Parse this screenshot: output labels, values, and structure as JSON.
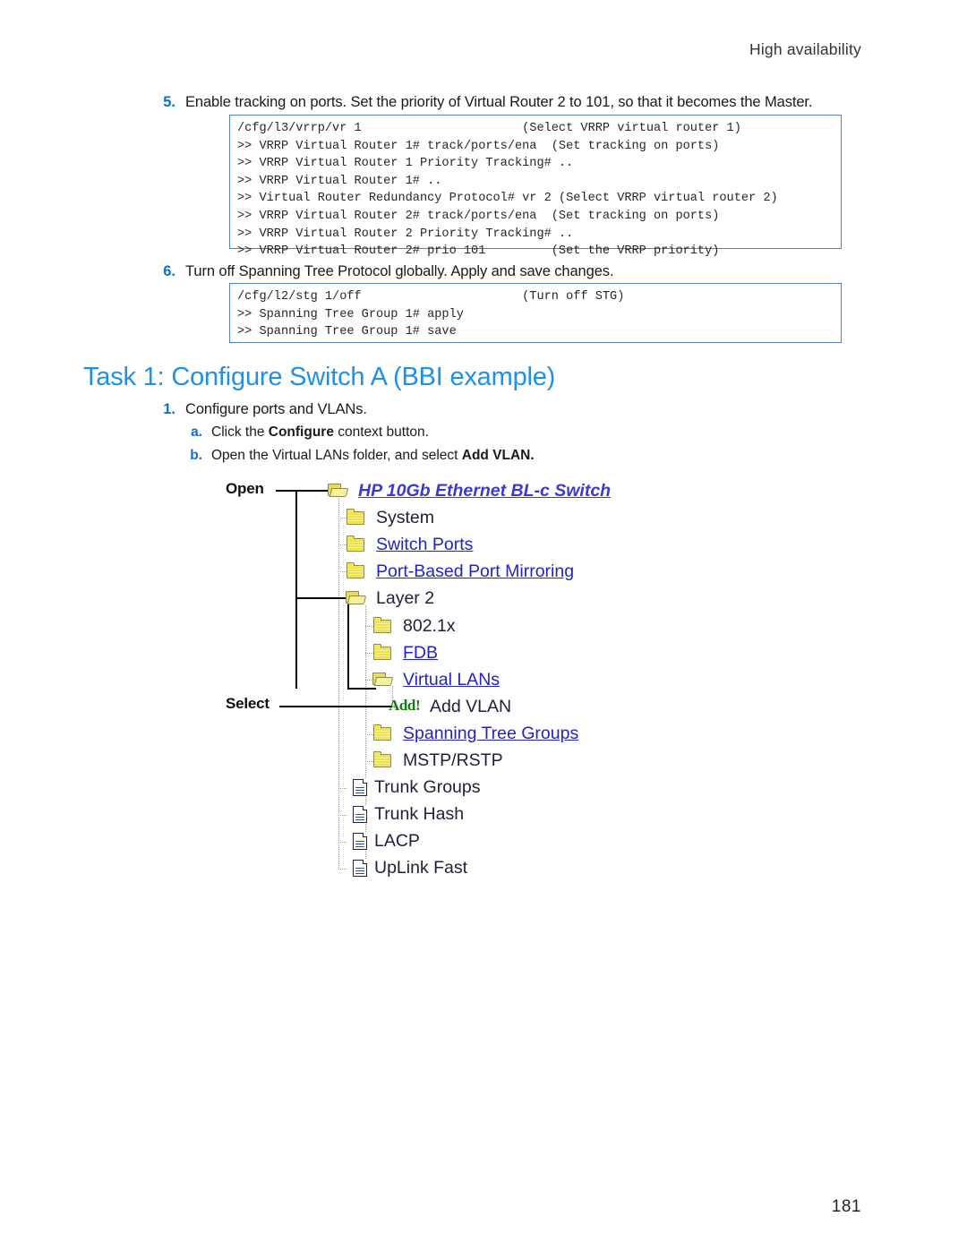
{
  "header": {
    "running_head": "High availability"
  },
  "footer": {
    "page_number": "181"
  },
  "steps": [
    {
      "num": "5.",
      "text": "Enable tracking on ports. Set the priority of Virtual Router 2 to 101, so that it becomes the Master."
    },
    {
      "num": "6.",
      "text": "Turn off Spanning Tree Protocol globally. Apply and save changes."
    }
  ],
  "code_blocks": [
    {
      "name": "vrrp-tracking-cli",
      "lines": [
        "/cfg/l3/vrrp/vr 1                      (Select VRRP virtual router 1)",
        ">> VRRP Virtual Router 1# track/ports/ena  (Set tracking on ports)",
        ">> VRRP Virtual Router 1 Priority Tracking# ..",
        ">> VRRP Virtual Router 1# ..",
        ">> Virtual Router Redundancy Protocol# vr 2 (Select VRRP virtual router 2)",
        ">> VRRP Virtual Router 2# track/ports/ena  (Set tracking on ports)",
        ">> VRRP Virtual Router 2 Priority Tracking# ..",
        ">> VRRP Virtual Router 2# prio 101         (Set the VRRP priority)"
      ]
    },
    {
      "name": "stg-off-cli",
      "lines": [
        "/cfg/l2/stg 1/off                      (Turn off STG)",
        ">> Spanning Tree Group 1# apply",
        ">> Spanning Tree Group 1# save"
      ]
    }
  ],
  "task": {
    "heading": "Task 1: Configure Switch A (BBI example)",
    "step": {
      "num": "1.",
      "text": "Configure ports and VLANs."
    },
    "substeps": [
      {
        "letter": "a.",
        "pre": "Click the ",
        "bold": "Configure",
        "post": " context button."
      },
      {
        "letter": "b.",
        "pre": "Open the Virtual LANs folder, and select ",
        "bold": "Add VLAN.",
        "post": ""
      }
    ]
  },
  "tree_figure": {
    "annotations": [
      {
        "label": "Open"
      },
      {
        "label": "Select"
      }
    ],
    "items": [
      {
        "label": "HP 10Gb Ethernet BL-c Switch",
        "icon": "folder-open-icon",
        "style": "root"
      },
      {
        "label": "System",
        "icon": "folder-closed-icon",
        "style": "plain"
      },
      {
        "label": "Switch Ports",
        "icon": "folder-closed-icon",
        "style": "link"
      },
      {
        "label": "Port-Based Port Mirroring",
        "icon": "folder-closed-icon",
        "style": "link"
      },
      {
        "label": "Layer 2",
        "icon": "folder-open-icon",
        "style": "plain"
      },
      {
        "label": "802.1x",
        "icon": "folder-closed-icon",
        "style": "plain"
      },
      {
        "label": "FDB",
        "icon": "folder-closed-icon",
        "style": "link"
      },
      {
        "label": "Virtual LANs",
        "icon": "folder-open-icon",
        "style": "link"
      },
      {
        "label": "Add VLAN",
        "icon": "add-bang-icon",
        "style": "plain"
      },
      {
        "label": "Spanning Tree Groups",
        "icon": "folder-closed-icon",
        "style": "link"
      },
      {
        "label": "MSTP/RSTP",
        "icon": "folder-closed-icon",
        "style": "plain"
      },
      {
        "label": "Trunk Groups",
        "icon": "page-icon",
        "style": "plain"
      },
      {
        "label": "Trunk Hash",
        "icon": "page-icon",
        "style": "plain"
      },
      {
        "label": "LACP",
        "icon": "page-icon",
        "style": "plain"
      },
      {
        "label": "UpLink Fast",
        "icon": "page-icon",
        "style": "plain"
      }
    ],
    "add_bang_text": "Add!"
  },
  "colors": {
    "accent_blue": "#1e90e8",
    "list_marker_blue": "#0d6ecd",
    "link_blue": "#2222cc",
    "code_border": "#4f7fd0",
    "folder_yellow": "#f2e85c",
    "add_green": "#117a11"
  }
}
